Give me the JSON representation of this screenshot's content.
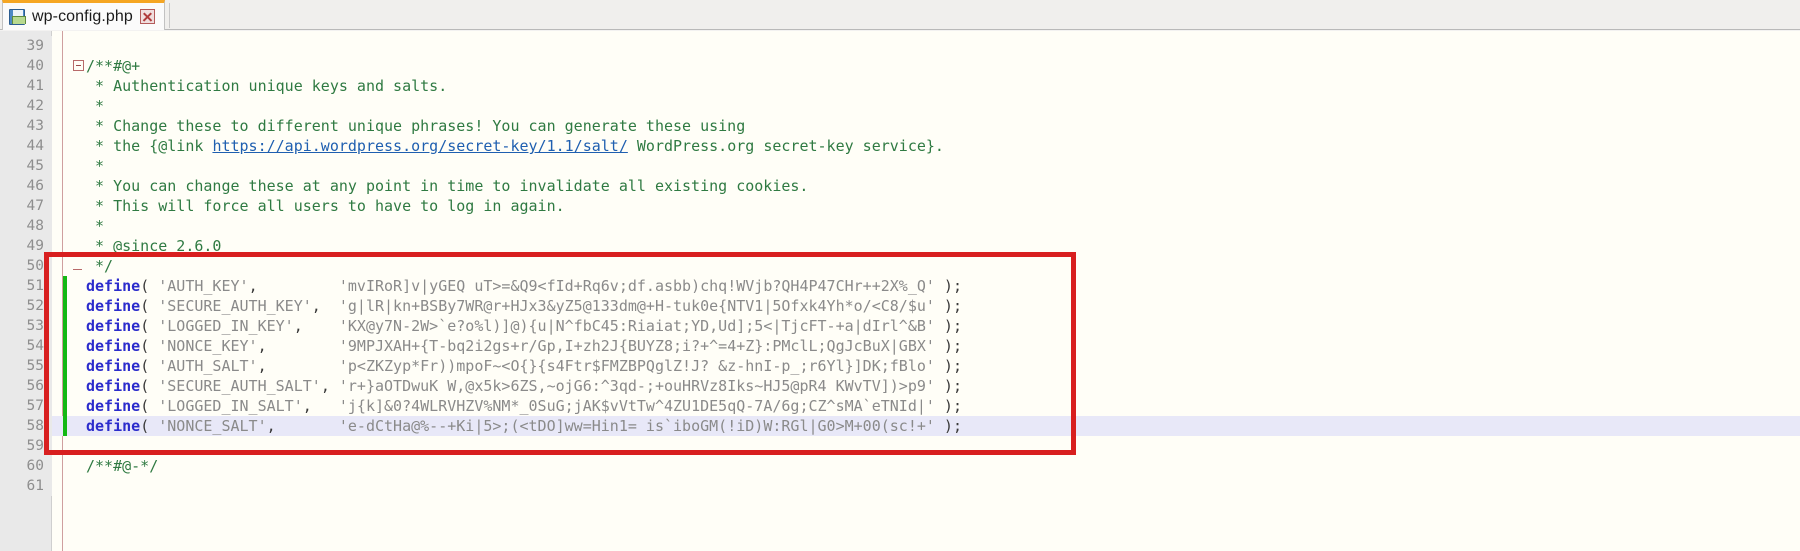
{
  "window": {
    "tab": {
      "filename": "wp-config.php",
      "save_icon": "floppy-disk-icon",
      "close_icon": "close-x-icon"
    }
  },
  "editor": {
    "language": "php",
    "current_line": 58,
    "first_visible_line": 39,
    "last_visible_line": 61,
    "colors": {
      "background": "#fffef7",
      "gutter": "#e9e9e9",
      "comment": "#2f7a42",
      "keyword": "#2c2ccc",
      "string": "#8a8a8a",
      "link": "#1f5fb0",
      "current_line_highlight": "#e8e8f8",
      "change_marker": "#14b814",
      "annotation": "#d81f1f"
    },
    "annotation": {
      "type": "rectangle",
      "color": "#d81f1f",
      "covers_lines": "50-59"
    },
    "lines": [
      {
        "n": 39,
        "segments": []
      },
      {
        "n": 40,
        "fold": "open",
        "segments": [
          {
            "t": "cmt",
            "s": "/**#@+"
          }
        ]
      },
      {
        "n": 41,
        "segments": [
          {
            "t": "cmt",
            "s": " * Authentication unique keys and salts."
          }
        ]
      },
      {
        "n": 42,
        "segments": [
          {
            "t": "cmt",
            "s": " *"
          }
        ]
      },
      {
        "n": 43,
        "segments": [
          {
            "t": "cmt",
            "s": " * Change these to different unique phrases! You can generate these using"
          }
        ]
      },
      {
        "n": 44,
        "segments": [
          {
            "t": "cmt",
            "s": " * the {@link "
          },
          {
            "t": "link",
            "s": "https://api.wordpress.org/secret-key/1.1/salt/"
          },
          {
            "t": "cmt",
            "s": " WordPress.org secret-key service}."
          }
        ]
      },
      {
        "n": 45,
        "segments": [
          {
            "t": "cmt",
            "s": " *"
          }
        ]
      },
      {
        "n": 46,
        "segments": [
          {
            "t": "cmt",
            "s": " * You can change these at any point in time to invalidate all existing cookies."
          }
        ]
      },
      {
        "n": 47,
        "segments": [
          {
            "t": "cmt",
            "s": " * This will force all users to have to log in again."
          }
        ]
      },
      {
        "n": 48,
        "segments": [
          {
            "t": "cmt",
            "s": " *"
          }
        ]
      },
      {
        "n": 49,
        "segments": [
          {
            "t": "cmt",
            "s": " * @since 2.6.0"
          }
        ]
      },
      {
        "n": 50,
        "fold": "close",
        "segments": [
          {
            "t": "cmt",
            "s": " */"
          }
        ]
      },
      {
        "n": 51,
        "changed": true,
        "segments": [
          {
            "t": "kw",
            "s": "define"
          },
          {
            "t": "punc",
            "s": "( "
          },
          {
            "t": "str",
            "s": "'AUTH_KEY'"
          },
          {
            "t": "punc",
            "s": ",         "
          },
          {
            "t": "str",
            "s": "'mvIRoR]v|yGEQ uT>=&Q9<fId+Rq6v;df.asbb)chq!WVjb?QH4P47CHr++2X%_Q'"
          },
          {
            "t": "punc",
            "s": " );"
          }
        ]
      },
      {
        "n": 52,
        "changed": true,
        "segments": [
          {
            "t": "kw",
            "s": "define"
          },
          {
            "t": "punc",
            "s": "( "
          },
          {
            "t": "str",
            "s": "'SECURE_AUTH_KEY'"
          },
          {
            "t": "punc",
            "s": ",  "
          },
          {
            "t": "str",
            "s": "'g|lR|kn+BSBy7WR@r+HJx3&yZ5@133dm@+H-tuk0e{NTV1|5Ofxk4Yh*o/<C8/$u'"
          },
          {
            "t": "punc",
            "s": " );"
          }
        ]
      },
      {
        "n": 53,
        "changed": true,
        "segments": [
          {
            "t": "kw",
            "s": "define"
          },
          {
            "t": "punc",
            "s": "( "
          },
          {
            "t": "str",
            "s": "'LOGGED_IN_KEY'"
          },
          {
            "t": "punc",
            "s": ",    "
          },
          {
            "t": "str",
            "s": "'KX@y7N-2W>`e?o%l)]@){u|N^fbC45:Riaiat;YD,Ud];5<|TjcFT-+a|dIrl^&B'"
          },
          {
            "t": "punc",
            "s": " );"
          }
        ]
      },
      {
        "n": 54,
        "changed": true,
        "segments": [
          {
            "t": "kw",
            "s": "define"
          },
          {
            "t": "punc",
            "s": "( "
          },
          {
            "t": "str",
            "s": "'NONCE_KEY'"
          },
          {
            "t": "punc",
            "s": ",        "
          },
          {
            "t": "str",
            "s": "'9MPJXAH+{T-bq2i2gs+r/Gp,I+zh2J{BUYZ8;i?+^=4+Z}:PMclL;QgJcBuX|GBX'"
          },
          {
            "t": "punc",
            "s": " );"
          }
        ]
      },
      {
        "n": 55,
        "changed": true,
        "segments": [
          {
            "t": "kw",
            "s": "define"
          },
          {
            "t": "punc",
            "s": "( "
          },
          {
            "t": "str",
            "s": "'AUTH_SALT'"
          },
          {
            "t": "punc",
            "s": ",        "
          },
          {
            "t": "str",
            "s": "'p<ZKZyp*Fr))mpoF~<O{}{s4Ftr$FMZBPQglZ!J? &z-hnI-p_;r6Yl}]DK;fBlo'"
          },
          {
            "t": "punc",
            "s": " );"
          }
        ]
      },
      {
        "n": 56,
        "changed": true,
        "segments": [
          {
            "t": "kw",
            "s": "define"
          },
          {
            "t": "punc",
            "s": "( "
          },
          {
            "t": "str",
            "s": "'SECURE_AUTH_SALT'"
          },
          {
            "t": "punc",
            "s": ", "
          },
          {
            "t": "str",
            "s": "'r+}aOTDwuK W,@x5k>6ZS,~ojG6:^3qd-;+ouHRVz8Iks~HJ5@pR4 KWvTV])>p9'"
          },
          {
            "t": "punc",
            "s": " );"
          }
        ]
      },
      {
        "n": 57,
        "changed": true,
        "segments": [
          {
            "t": "kw",
            "s": "define"
          },
          {
            "t": "punc",
            "s": "( "
          },
          {
            "t": "str",
            "s": "'LOGGED_IN_SALT'"
          },
          {
            "t": "punc",
            "s": ",   "
          },
          {
            "t": "str",
            "s": "'j{k]&0?4WLRVHZV%NM*_0SuG;jAK$vVtTw^4ZU1DE5qQ-7A/6g;CZ^sMA`eTNId|'"
          },
          {
            "t": "punc",
            "s": " );"
          }
        ]
      },
      {
        "n": 58,
        "changed": true,
        "current": true,
        "segments": [
          {
            "t": "kw",
            "s": "define"
          },
          {
            "t": "punc",
            "s": "( "
          },
          {
            "t": "str",
            "s": "'NONCE_SALT'"
          },
          {
            "t": "punc",
            "s": ",       "
          },
          {
            "t": "str",
            "s": "'e-dCtHa@%--+Ki|5>;(<tDO]ww=Hin1= is`iboGM(!iD)W:RGl|G0>M+00(sc!+'"
          },
          {
            "t": "punc",
            "s": " );"
          }
        ]
      },
      {
        "n": 59,
        "segments": []
      },
      {
        "n": 60,
        "segments": [
          {
            "t": "cmt",
            "s": "/**#@-*/"
          }
        ]
      },
      {
        "n": 61,
        "segments": []
      }
    ]
  }
}
